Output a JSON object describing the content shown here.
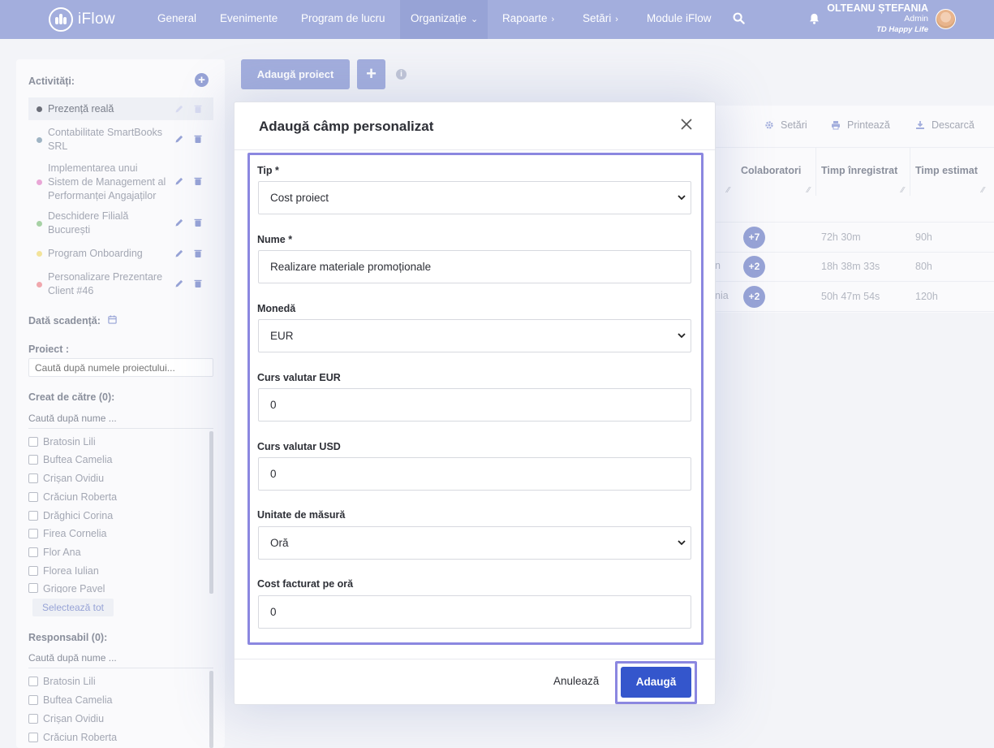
{
  "brand": {
    "name": "iFlow",
    "accent": "#a3aedd",
    "primary_button": "#3456cc",
    "highlight": "#8b87e0"
  },
  "nav": {
    "items": [
      {
        "label": "General"
      },
      {
        "label": "Evenimente"
      },
      {
        "label": "Program de lucru"
      },
      {
        "label": "Organizație",
        "chevron": "⌄"
      },
      {
        "label": "Rapoarte",
        "chevron": "›"
      },
      {
        "label": "Setări",
        "chevron": "›"
      },
      {
        "label": "Module iFlow"
      }
    ],
    "active": "Organizație"
  },
  "user": {
    "name": "OLTEANU ȘTEFANIA",
    "role": "Admin",
    "company": "TD Happy Life"
  },
  "sidebar": {
    "activities_title": "Activități:",
    "activities": [
      {
        "label": "Prezență reală",
        "color": "#6b6e78"
      },
      {
        "label": "Contabilitate SmartBooks SRL",
        "color": "#9fb4c4"
      },
      {
        "label": "Implementarea unui Sistem de Management al Performanței Angajaților",
        "color": "#e9a6d6"
      },
      {
        "label": "Deschidere Filială București",
        "color": "#a7d1a5"
      },
      {
        "label": "Program Onboarding",
        "color": "#f3e39a"
      },
      {
        "label": "Personalizare Prezentare Client #46",
        "color": "#f0a7ad"
      }
    ],
    "due_date_label": "Dată scadență:",
    "project_label": "Proiect :",
    "project_placeholder": "Caută după numele proiectului...",
    "created_by_label": "Creat de către (0):",
    "created_by_search": "Caută după nume ...",
    "created_by_users": [
      "Bratosin Lili",
      "Buftea Camelia",
      "Crișan Ovidiu",
      "Crăciun Roberta",
      "Drăghici Corina",
      "Firea Cornelia",
      "Flor Ana",
      "Florea Iulian",
      "Grigore Pavel"
    ],
    "select_all": "Selectează tot",
    "responsible_label": "Responsabil (0):",
    "responsible_search": "Caută după nume ...",
    "responsible_users": [
      "Bratosin Lili",
      "Buftea Camelia",
      "Crișan Ovidiu",
      "Crăciun Roberta"
    ]
  },
  "main": {
    "add_project": "Adaugă proiect",
    "add_plus": "+",
    "info": "i",
    "toolbar": {
      "settings": "Setări",
      "print": "Printează",
      "download": "Descarcă"
    },
    "columns": [
      "Colaboratori",
      "Timp înregistrat",
      "Timp estimat"
    ],
    "rows": [
      {
        "partial": "",
        "collaborators": "+7",
        "recorded": "72h 30m",
        "estimated": "90h"
      },
      {
        "partial": "n",
        "collaborators": "+2",
        "recorded": "18h 38m 33s",
        "estimated": "80h"
      },
      {
        "partial": "nia",
        "collaborators": "+2",
        "recorded": "50h 47m 54s",
        "estimated": "120h"
      }
    ]
  },
  "modal": {
    "title": "Adaugă câmp personalizat",
    "fields": {
      "tip": {
        "label": "Tip *",
        "value": "Cost proiect"
      },
      "nume": {
        "label": "Nume *",
        "value": "Realizare materiale promoționale"
      },
      "moneda": {
        "label": "Monedă",
        "value": "EUR"
      },
      "curs_eur": {
        "label": "Curs valutar EUR",
        "value": "0"
      },
      "curs_usd": {
        "label": "Curs valutar USD",
        "value": "0"
      },
      "unitate": {
        "label": "Unitate de măsură",
        "value": "Oră"
      },
      "cost": {
        "label": "Cost facturat pe oră",
        "value": "0"
      }
    },
    "cancel": "Anulează",
    "submit": "Adaugă"
  }
}
